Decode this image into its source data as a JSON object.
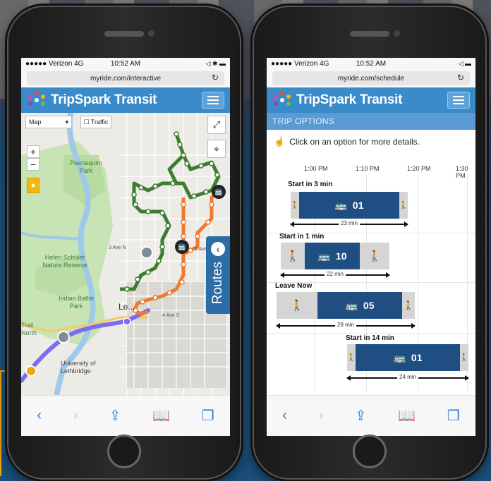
{
  "left_phone": {
    "status": {
      "carrier": "●●●●● Verizon 4G",
      "time": "10:52 AM",
      "icons": "◁ ✱ ▬"
    },
    "url": "myride.com/interactive",
    "app_title": "TripSpark Transit",
    "map": {
      "type_select": "Map",
      "traffic_label": "Traffic",
      "zoom_in": "+",
      "zoom_out": "−",
      "labels": {
        "peenaquim": "Peenaquim Park",
        "helen": "Helen Schuler Nature Reserve",
        "indian": "Indian Battle Park",
        "trail": "Trail North",
        "uni": "University of Lethbridge",
        "leth": "Le...",
        "av5": "5 Ave N",
        "avs": "4 Ave S",
        "st3": "3 Ave N"
      },
      "routes_label": "Routes"
    }
  },
  "right_phone": {
    "status": {
      "carrier": "●●●●● Verizon 4G",
      "time": "10:52 AM",
      "icons": "◁ ▬"
    },
    "url": "myride.com/schedule",
    "app_title": "TripSpark Transit",
    "section_title": "TRIP OPTIONS",
    "instruction": "Click on an option for more details.",
    "times": [
      "1:00 PM",
      "1:10 PM",
      "1:20 PM",
      "1:30 PM"
    ],
    "trips": [
      {
        "label": "Start in 3 min",
        "route": "01",
        "duration": "23 min"
      },
      {
        "label": "Start in 1 min",
        "route": "10",
        "duration": "22 min"
      },
      {
        "label": "Leave Now",
        "route": "05",
        "duration": "28 min"
      },
      {
        "label": "Start in 14 min",
        "route": "01",
        "duration": "24 min"
      }
    ]
  },
  "colors": {
    "header": "#3a8bc9",
    "green_route": "#3c7d2f",
    "orange_route": "#f07a2c",
    "purple_route": "#7b6cf0",
    "bus_block": "#1f4f82",
    "callout": "#f0a70b"
  },
  "bottom_bar_icons": [
    "back-arrow-icon",
    "forward-arrow-icon",
    "share-icon",
    "bookmarks-icon",
    "tabs-icon"
  ]
}
